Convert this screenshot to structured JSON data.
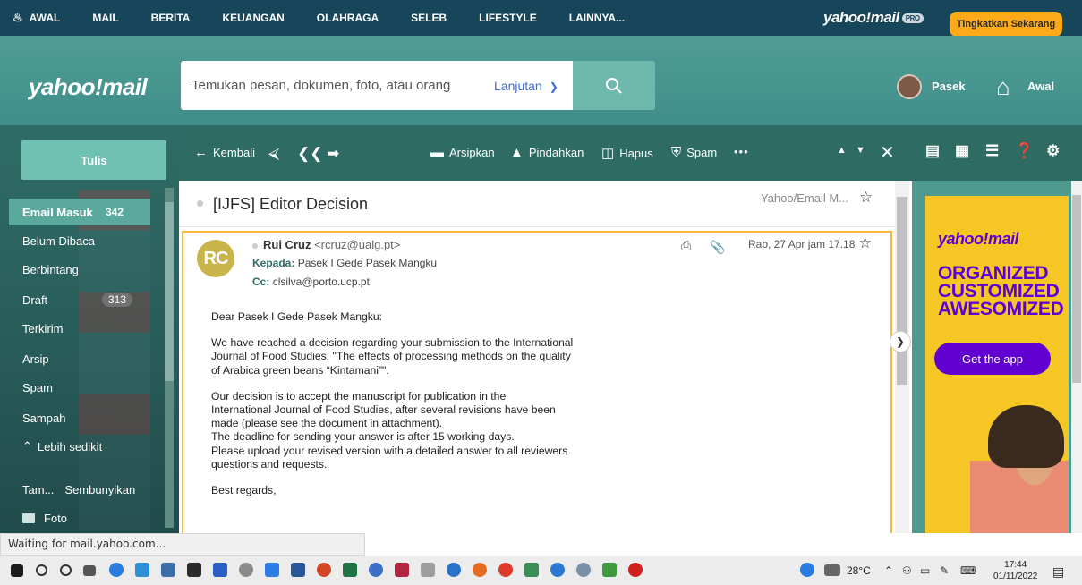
{
  "topnav": {
    "items": [
      "AWAL",
      "MAIL",
      "BERITA",
      "KEUANGAN",
      "OLAHRAGA",
      "SELEB",
      "LIFESTYLE",
      "LAINNYA..."
    ],
    "brand": "yahoo!mail",
    "pro_badge": "PRO",
    "upgrade_label": "Tingkatkan Sekarang"
  },
  "header": {
    "logo": "yahoo!mail",
    "search_placeholder": "Temukan pesan, dokumen, foto, atau orang",
    "advanced_label": "Lanjutan",
    "user_name": "Pasek",
    "home_label": "Awal"
  },
  "sidebar": {
    "compose_label": "Tulis",
    "folders": [
      {
        "label": "Email Masuk",
        "count": "342"
      },
      {
        "label": "Belum Dibaca",
        "count": ""
      },
      {
        "label": "Berbintang",
        "count": ""
      },
      {
        "label": "Draft",
        "count": "313"
      },
      {
        "label": "Terkirim",
        "count": ""
      },
      {
        "label": "Arsip",
        "count": ""
      },
      {
        "label": "Spam",
        "count": ""
      },
      {
        "label": "Sampah",
        "count": ""
      }
    ],
    "less_label": "Lebih sedikit",
    "view_more_label": "Tam...",
    "hide_label": "Sembunyikan",
    "photos_label": "Foto"
  },
  "toolbar": {
    "back_label": "Kembali",
    "archive_label": "Arsipkan",
    "move_label": "Pindahkan",
    "delete_label": "Hapus",
    "spam_label": "Spam",
    "more_label": "•••"
  },
  "message": {
    "subject": "[IJFS] Editor Decision",
    "folder_tag": "Yahoo/Email M...",
    "avatar_initials": "RC",
    "sender_name": "Rui Cruz",
    "sender_email": "<rcruz@ualg.pt>",
    "to_label": "Kepada:",
    "to_value": "Pasek I Gede Pasek Mangku",
    "cc_label": "Cc:",
    "cc_value": "clsilva@porto.ucp.pt",
    "date": "Rab, 27 Apr jam 17.18",
    "greeting": "Dear Pasek I Gede Pasek Mangku:",
    "para1_l1": "We have reached a decision regarding your submission to the International",
    "para1_l2": "Journal of Food Studies: \"The effects of processing methods on the quality",
    "para1_l3": "of Arabica green beans “Kintamani”\".",
    "para2_l1": "Our decision is to accept the manuscript for publication in the",
    "para2_l2": "International Journal of Food Studies, after several revisions have been",
    "para2_l3": "made (please see the document in attachment).",
    "para2_l4": "The deadline for sending your answer is after 15 working days.",
    "para2_l5": "Please upload your revised version with  a detailed answer to all reviewers",
    "para2_l6": "questions and requests.",
    "closing": "Best regards,"
  },
  "ad": {
    "logo": "yahoo!mail",
    "line1": "ORGANIZED",
    "line2": "CUSTOMIZED",
    "line3": "AWESOMIZED",
    "cta": "Get the app"
  },
  "status_text": "Waiting for mail.yahoo.com...",
  "taskbar": {
    "temperature": "28°C",
    "time": "17:44",
    "date": "01/11/2022"
  },
  "colors": {
    "nav_bg": "#17465a",
    "header_bg": "#3f8e8a",
    "sidebar_bg": "#2f6c66",
    "accent_orange": "#fca91a",
    "ad_yellow": "#f6c624",
    "ad_purple": "#6001d2"
  }
}
